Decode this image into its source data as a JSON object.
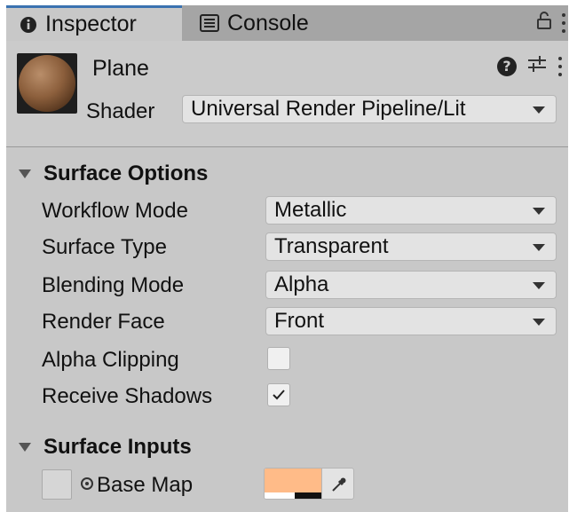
{
  "tabs": [
    {
      "label": "Inspector",
      "icon": "info-icon",
      "active": true
    },
    {
      "label": "Console",
      "icon": "console-icon",
      "active": false
    }
  ],
  "material": {
    "name": "Plane",
    "shader_label": "Shader",
    "shader_value": "Universal Render Pipeline/Lit"
  },
  "surface_options": {
    "title": "Surface Options",
    "workflow_mode": {
      "label": "Workflow Mode",
      "value": "Metallic"
    },
    "surface_type": {
      "label": "Surface Type",
      "value": "Transparent"
    },
    "blending_mode": {
      "label": "Blending Mode",
      "value": "Alpha"
    },
    "render_face": {
      "label": "Render Face",
      "value": "Front"
    },
    "alpha_clipping": {
      "label": "Alpha Clipping",
      "checked": false
    },
    "receive_shadows": {
      "label": "Receive Shadows",
      "checked": true
    }
  },
  "surface_inputs": {
    "title": "Surface Inputs",
    "base_map": {
      "label": "Base Map",
      "color": "#ffbb88"
    }
  },
  "colors": {
    "accent": "#3a72b0",
    "panel": "#c8c8c8",
    "tabbar": "#a5a5a5"
  }
}
